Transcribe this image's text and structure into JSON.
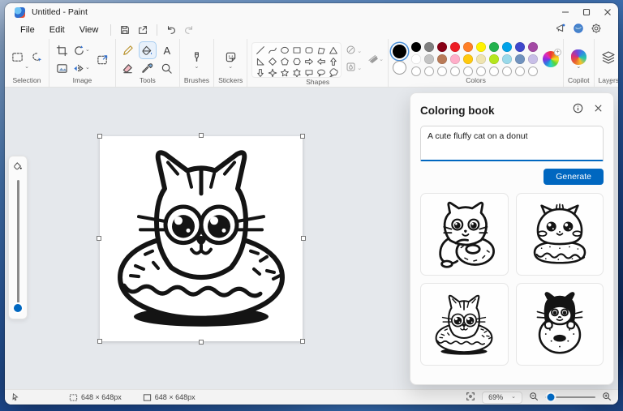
{
  "window": {
    "title": "Untitled - Paint"
  },
  "menu": {
    "items": [
      "File",
      "Edit",
      "View"
    ]
  },
  "ribbon": {
    "sections": {
      "selection": "Selection",
      "image": "Image",
      "tools": "Tools",
      "brushes": "Brushes",
      "stickers": "Stickers",
      "shapes": "Shapes",
      "colors": "Colors",
      "copilot": "Copilot",
      "layers": "Layers"
    },
    "text_tool_label": "A",
    "shapes_items": [
      "line",
      "curve",
      "oval",
      "rectangle",
      "rounded-rectangle",
      "polygon",
      "triangle",
      "right-triangle",
      "diamond",
      "pentagon",
      "hexagon",
      "arrow-right",
      "arrow-left",
      "arrow-up",
      "arrow-down",
      "star-4",
      "star-5",
      "star-6",
      "speech-rect",
      "speech-oval",
      "thought-cloud",
      "heart",
      "lightning"
    ],
    "palette": {
      "foreground": "#000000",
      "background": "#ffffff",
      "row1": [
        "#000000",
        "#7f7f7f",
        "#880015",
        "#ed1c24",
        "#ff7f27",
        "#fff200",
        "#22b14c",
        "#00a2e8",
        "#3f48cc",
        "#a349a4"
      ],
      "row2": [
        "#ffffff",
        "#c3c3c3",
        "#b97a57",
        "#ffaec9",
        "#ffc90e",
        "#efe4b0",
        "#b5e61d",
        "#99d9ea",
        "#7092be",
        "#c8bfe7"
      ],
      "empty_count": 10
    }
  },
  "panel": {
    "title": "Coloring book",
    "prompt_value": "A cute fluffy cat on a donut",
    "generate_label": "Generate",
    "results": [
      {
        "description": "Cat hugging a donut"
      },
      {
        "description": "Fluffy cat sitting on a donut"
      },
      {
        "description": "Cat head inside a donut"
      },
      {
        "description": "Black and white cat behind a donut"
      }
    ]
  },
  "canvas": {
    "selection_description": "Cat head inside a donut line art"
  },
  "statusbar": {
    "selection_size": "648 × 648px",
    "image_size": "648 × 648px",
    "zoom": "69%"
  },
  "theme": {
    "accent": "#0067c0"
  }
}
